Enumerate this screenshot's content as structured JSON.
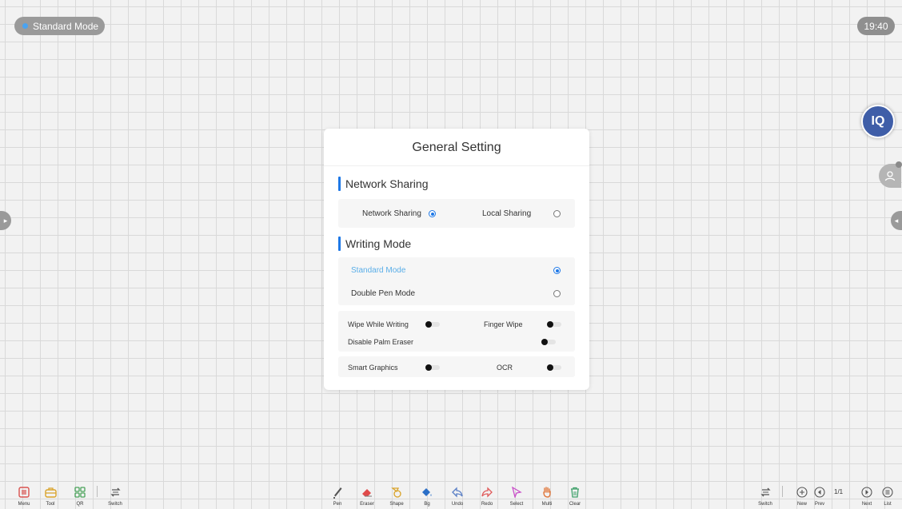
{
  "status": {
    "mode_label": "Standard Mode",
    "time": "19:40"
  },
  "floating": {
    "iq_label": "IQ"
  },
  "dialog": {
    "title": "General Setting",
    "network": {
      "heading": "Network Sharing",
      "option1": "Network Sharing",
      "option1_selected": true,
      "option2": "Local Sharing",
      "option2_selected": false
    },
    "writing": {
      "heading": "Writing Mode",
      "option1": "Standard Mode",
      "option1_selected": true,
      "option2": "Double Pen Mode",
      "option2_selected": false
    },
    "toggles": {
      "wipe_while_writing": "Wipe While Writing",
      "finger_wipe": "Finger Wipe",
      "disable_palm_eraser": "Disable Palm Eraser",
      "smart_graphics": "Smart Graphics",
      "ocr": "OCR"
    }
  },
  "toolbar": {
    "left": [
      "Menu",
      "Tool",
      "QR",
      "Switch"
    ],
    "center": [
      "Pen",
      "Eraser",
      "Shape",
      "Bg",
      "Undo",
      "Redo",
      "Select",
      "Multi",
      "Clear"
    ],
    "right": {
      "switch": "Switch",
      "new": "New",
      "prev": "Prev",
      "page": "1/1",
      "next": "Next",
      "list": "List"
    }
  },
  "colors": {
    "accent": "#1e78e6",
    "eraser": "#e04b4b",
    "menu": "#d9534f",
    "tool": "#d9a32a",
    "qr": "#4aa25a",
    "clear": "#3fa06a",
    "select": "#c94fc9",
    "hand": "#e07a40"
  }
}
